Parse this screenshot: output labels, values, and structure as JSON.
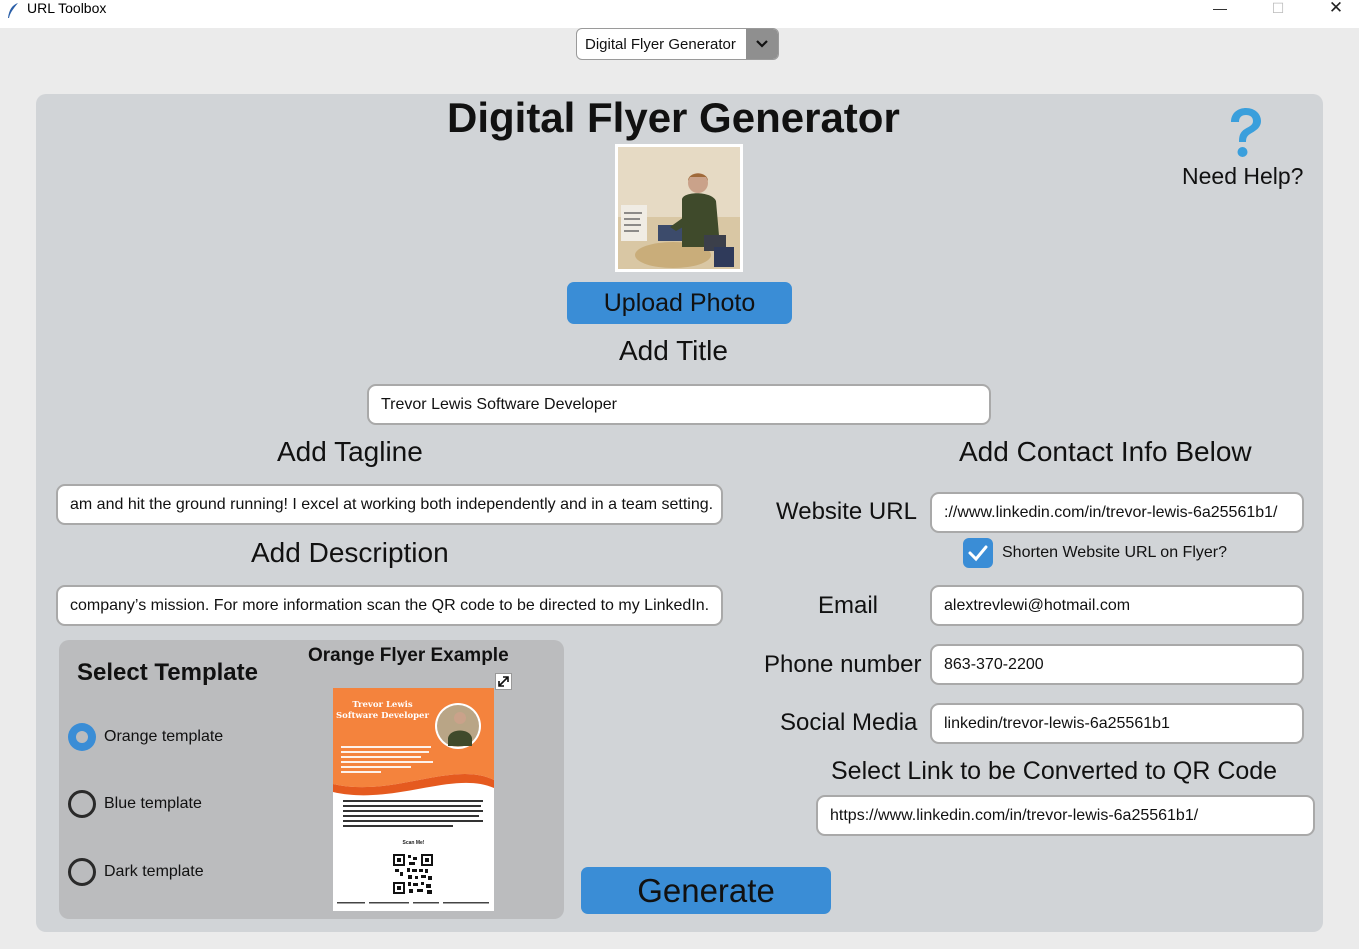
{
  "window": {
    "title": "URL Toolbox",
    "controls": {
      "minimize": "—",
      "maximize": "☐",
      "close": "✕"
    }
  },
  "mode_selector": {
    "value": "Digital Flyer Generator",
    "arrow_icon": "chevron-down-icon"
  },
  "header": {
    "title": "Digital Flyer Generator",
    "help_label": "Need Help?",
    "help_icon": "question-mark-icon"
  },
  "photo": {
    "upload_label": "Upload Photo"
  },
  "title_section": {
    "label": "Add Title",
    "value": "Trevor Lewis Software Developer"
  },
  "tagline": {
    "label": "Add Tagline",
    "value": "am and hit the ground running! I excel at working both independently and in a team setting."
  },
  "description": {
    "label": "Add Description",
    "value": "company’s mission. For more information scan the QR code to be directed to my LinkedIn."
  },
  "contact": {
    "heading": "Add Contact Info Below",
    "website_label": "Website URL",
    "website_value": "://www.linkedin.com/in/trevor-lewis-6a25561b1/",
    "shorten_label": "Shorten Website URL on Flyer?",
    "shorten_checked": true,
    "email_label": "Email",
    "email_value": "alextrevlewi@hotmail.com",
    "phone_label": "Phone number",
    "phone_value": "863-370-2200",
    "social_label": "Social Media",
    "social_value": "linkedin/trevor-lewis-6a25561b1"
  },
  "qr": {
    "label": "Select Link to be Converted to QR Code",
    "value": "https://www.linkedin.com/in/trevor-lewis-6a25561b1/"
  },
  "generate_label": "Generate",
  "templates": {
    "heading": "Select Template",
    "example_heading": "Orange Flyer Example",
    "options": [
      {
        "label": "Orange template",
        "selected": true
      },
      {
        "label": "Blue template",
        "selected": false
      },
      {
        "label": "Dark template",
        "selected": false
      }
    ]
  },
  "flyer_preview": {
    "name_line1": "Trevor Lewis",
    "name_line2": "Software Developer",
    "scan_text": "Scan Me!"
  },
  "colors": {
    "accent_blue": "#3a8dd6",
    "panel_gray": "#d1d4d7",
    "template_panel_gray": "#bbbcbe",
    "flyer_orange": "#f4833d"
  }
}
